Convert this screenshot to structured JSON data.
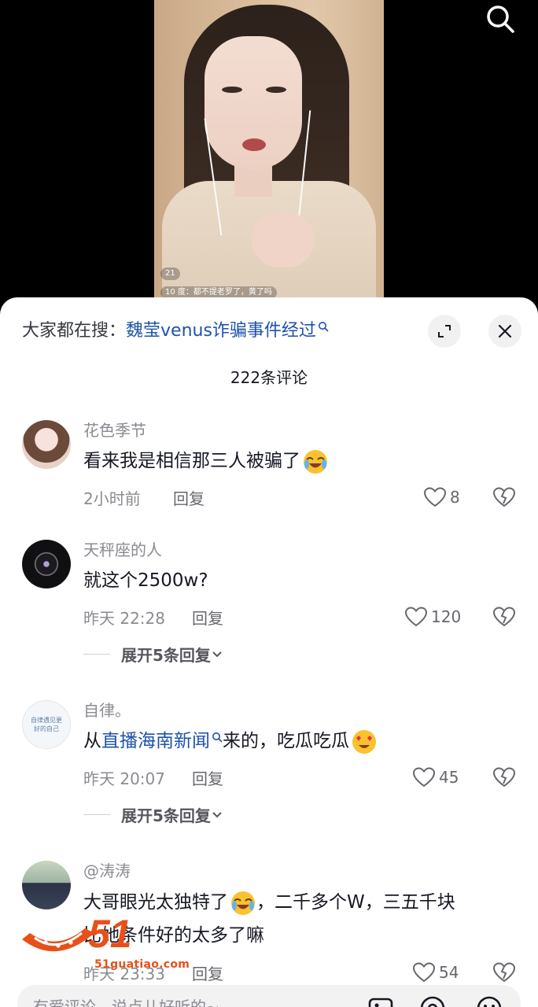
{
  "video": {
    "live_chat": [
      "都不提老罗了，黄了吗",
      "21",
      "10",
      "度："
    ]
  },
  "header": {
    "hot_search_prefix": "大家都在搜：",
    "hot_search_term": "魏莹venus诈骗事件经过",
    "comment_count": "222条评论"
  },
  "comments": [
    {
      "username": "花色季节",
      "text": "看来我是相信那三人被骗了",
      "time": "2小时前",
      "reply_label": "回复",
      "likes": "8"
    },
    {
      "username": "天秤座的人",
      "text": "就这个2500w?",
      "time": "昨天 22:28",
      "reply_label": "回复",
      "likes": "120",
      "expand_label": "展开5条回复"
    },
    {
      "username": "自律。",
      "text_prefix": "从",
      "text_link": "直播海南新闻",
      "text_suffix": "来的，吃瓜吃瓜",
      "time": "昨天 20:07",
      "reply_label": "回复",
      "likes": "45",
      "expand_label": "展开5条回复",
      "avatar_text": "自律遇见更好的自己"
    },
    {
      "username": "@涛涛",
      "text_line1_a": "大哥眼光太独特了",
      "text_line1_b": "，二千多个W，三五千块",
      "text_line2": "比她条件好的太多了嘛",
      "time": "昨天 23:33",
      "reply_label": "回复",
      "likes": "54"
    }
  ],
  "watermark": {
    "logo_text": "51",
    "site": "51guatiao.com"
  },
  "input_bar": {
    "placeholder": "有爱评论，说点儿好听的~"
  },
  "colors": {
    "link": "#1f52a8",
    "secondary_text": "#8a8b91",
    "primary_text": "#161823",
    "watermark": "#e8501a"
  }
}
